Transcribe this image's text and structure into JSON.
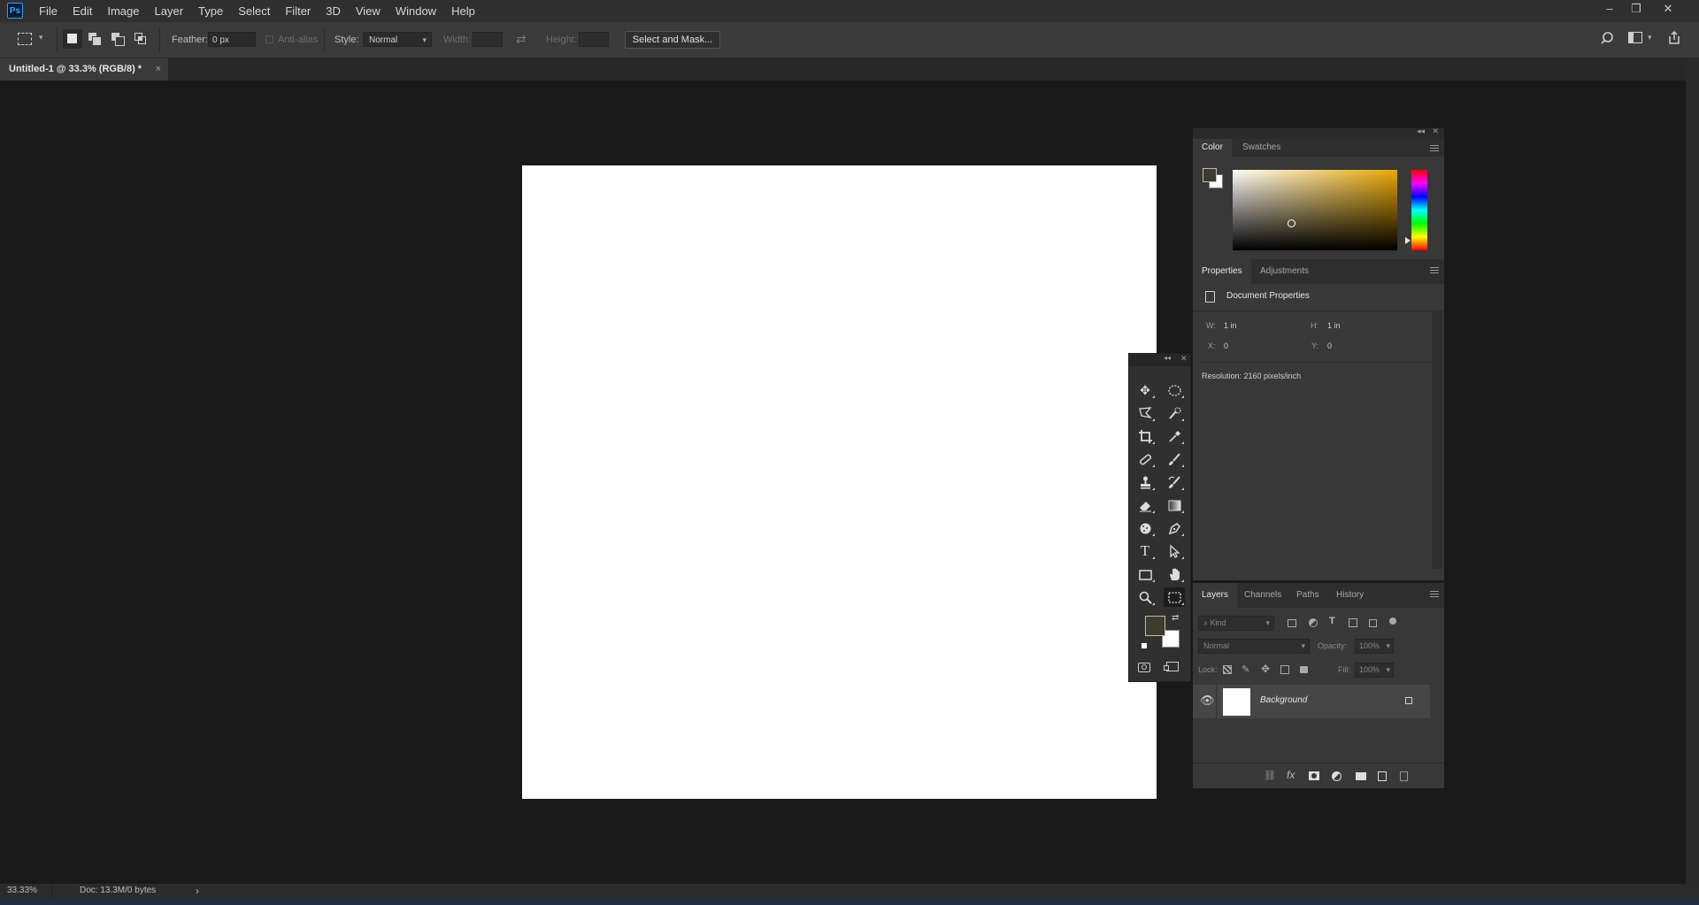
{
  "app": {
    "logo": "Ps"
  },
  "menu": [
    "File",
    "Edit",
    "Image",
    "Layer",
    "Type",
    "Select",
    "Filter",
    "3D",
    "View",
    "Window",
    "Help"
  ],
  "window_controls": {
    "minimize": "–",
    "restore": "❐",
    "close": "✕"
  },
  "options": {
    "feather_label": "Feather:",
    "feather_value": "0 px",
    "antialias_label": "Anti-alias",
    "style_label": "Style:",
    "style_value": "Normal",
    "width_label": "Width:",
    "height_label": "Height:",
    "select_mask_label": "Select and Mask..."
  },
  "document_tab": {
    "title": "Untitled-1 @ 33.3% (RGB/8) *",
    "close": "×"
  },
  "color_panel": {
    "tabs": [
      "Color",
      "Swatches"
    ],
    "foreground": "#3f3b2a",
    "background": "#ffffff",
    "hue_color": "#e8a800"
  },
  "properties_panel": {
    "tabs": [
      "Properties",
      "Adjustments"
    ],
    "section_title": "Document Properties",
    "w_label": "W:",
    "w_value": "1 in",
    "h_label": "H:",
    "h_value": "1 in",
    "x_label": "X:",
    "x_value": "0",
    "y_label": "Y:",
    "y_value": "0",
    "resolution": "Resolution: 2160 pixels/inch"
  },
  "layers_panel": {
    "tabs": [
      "Layers",
      "Channels",
      "Paths",
      "History"
    ],
    "kind_placeholder": "Kind",
    "blend_mode": "Normal",
    "opacity_label": "Opacity:",
    "opacity_value": "100%",
    "lock_label": "Lock:",
    "fill_label": "Fill:",
    "fill_value": "100%",
    "layers": [
      {
        "name": "Background",
        "visible": true,
        "locked": true
      }
    ]
  },
  "status": {
    "zoom": "33.33%",
    "doc_info": "Doc: 13.3M/0 bytes",
    "arrow": "›"
  },
  "tools": [
    "move",
    "elliptical-marquee",
    "polygonal-lasso",
    "quick-selection",
    "crop",
    "eyedropper",
    "spot-healing",
    "brush",
    "clone-stamp",
    "history-brush",
    "eraser",
    "gradient",
    "blur",
    "pen",
    "type",
    "path-selection",
    "rectangle",
    "hand",
    "zoom",
    "rectangular-marquee"
  ]
}
